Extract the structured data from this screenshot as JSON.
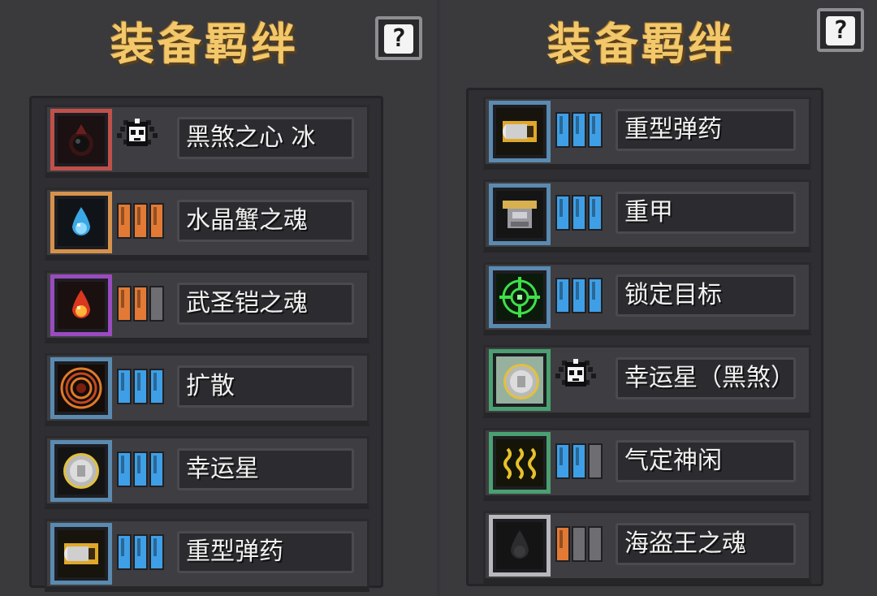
{
  "left": {
    "title": "装备羁绊",
    "help": "?",
    "rows": [
      {
        "name": "黑煞之心 冰",
        "icon": "dark-heart-icon",
        "border": "#c0504a",
        "badge": "skull-badge-icon",
        "level": null
      },
      {
        "name": "水晶蟹之魂",
        "icon": "crystal-crab-soul-icon",
        "border": "#d6924c",
        "bar_color": "#e27a35",
        "level": 3,
        "max": 3
      },
      {
        "name": "武圣铠之魂",
        "icon": "warrior-armor-soul-icon",
        "border": "#9a4bc0",
        "bar_color": "#e27a35",
        "level": 2,
        "max": 3
      },
      {
        "name": "扩散",
        "icon": "spread-icon",
        "border": "#5a8ab0",
        "bar_color": "#3f9fe6",
        "level": 3,
        "max": 3
      },
      {
        "name": "幸运星",
        "icon": "lucky-star-coin-icon",
        "border": "#5a8ab0",
        "bar_color": "#3f9fe6",
        "level": 3,
        "max": 3
      },
      {
        "name": "重型弹药",
        "icon": "heavy-ammo-icon",
        "border": "#5a8ab0",
        "bar_color": "#3f9fe6",
        "level": 3,
        "max": 3
      }
    ]
  },
  "right": {
    "title": "装备羁绊",
    "help": "?",
    "rows": [
      {
        "name": "重型弹药",
        "icon": "heavy-ammo-icon",
        "border": "#5a8ab0",
        "bar_color": "#3f9fe6",
        "level": 3,
        "max": 3
      },
      {
        "name": "重甲",
        "icon": "heavy-armor-icon",
        "border": "#5a8ab0",
        "bar_color": "#3f9fe6",
        "level": 3,
        "max": 3
      },
      {
        "name": "锁定目标",
        "icon": "lock-target-icon",
        "border": "#5a8ab0",
        "bar_color": "#3f9fe6",
        "level": 3,
        "max": 3
      },
      {
        "name": "幸运星（黑煞）",
        "icon": "lucky-star-dark-icon",
        "border": "#4aa070",
        "badge": "skull-badge-icon",
        "level": null
      },
      {
        "name": "气定神闲",
        "icon": "calm-steam-icon",
        "border": "#4aa070",
        "bar_color": "#3f9fe6",
        "level": 2,
        "max": 3
      },
      {
        "name": "海盗王之魂",
        "icon": "pirate-king-soul-icon",
        "border": "#b9b9bd",
        "bar_color": "#e27a35",
        "level": 1,
        "max": 3
      }
    ]
  }
}
